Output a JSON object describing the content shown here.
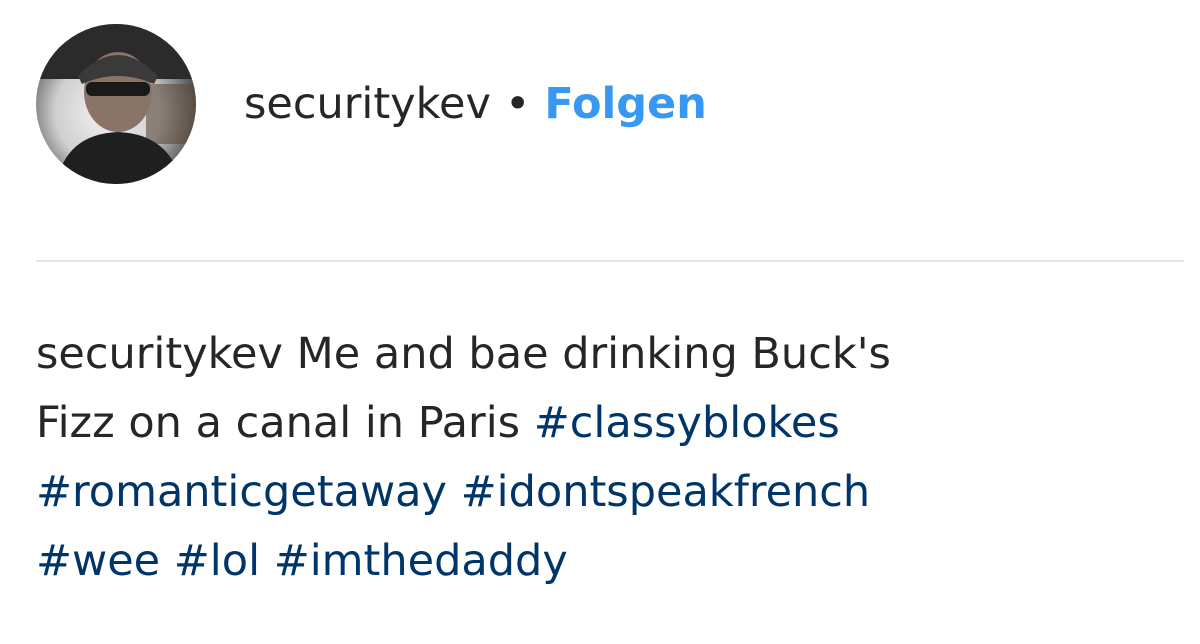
{
  "header": {
    "username": "securitykev",
    "separator": "•",
    "follow_label": "Folgen"
  },
  "caption": {
    "username": "securitykev",
    "text_part1": "Me and bae drinking Buck's",
    "text_part2": "Fizz on a canal in Paris",
    "hashtags": [
      "#classyblokes",
      "#romanticgetaway",
      "#idontspeakfrench",
      "#wee",
      "#lol",
      "#imthedaddy"
    ]
  },
  "colors": {
    "follow_link": "#3897f0",
    "hashtag_link": "#003569",
    "text": "#262626",
    "divider": "#e6e6e6"
  }
}
